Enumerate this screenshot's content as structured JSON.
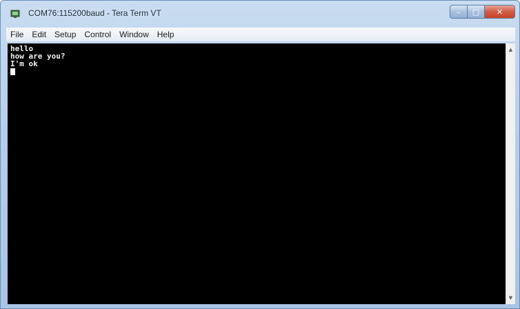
{
  "window": {
    "title": "COM76:115200baud - Tera Term VT",
    "app_icon": "tera-term-icon"
  },
  "controls": {
    "minimize_icon": "minimize-icon",
    "maximize_icon": "maximize-icon",
    "close_icon": "close-icon",
    "minimize_glyph": "–",
    "maximize_glyph": "□",
    "close_glyph": "✕"
  },
  "menu": {
    "items": [
      {
        "label": "File"
      },
      {
        "label": "Edit"
      },
      {
        "label": "Setup"
      },
      {
        "label": "Control"
      },
      {
        "label": "Window"
      },
      {
        "label": "Help"
      }
    ]
  },
  "terminal": {
    "lines": [
      "hello",
      "how are you?",
      "I'm ok"
    ],
    "background": "#000000",
    "foreground": "#f2f2f2"
  },
  "scrollbar": {
    "up_glyph": "▲",
    "down_glyph": "▼"
  },
  "colors": {
    "close_button": "#c7442b",
    "title_gradient": "#b5cde9"
  }
}
